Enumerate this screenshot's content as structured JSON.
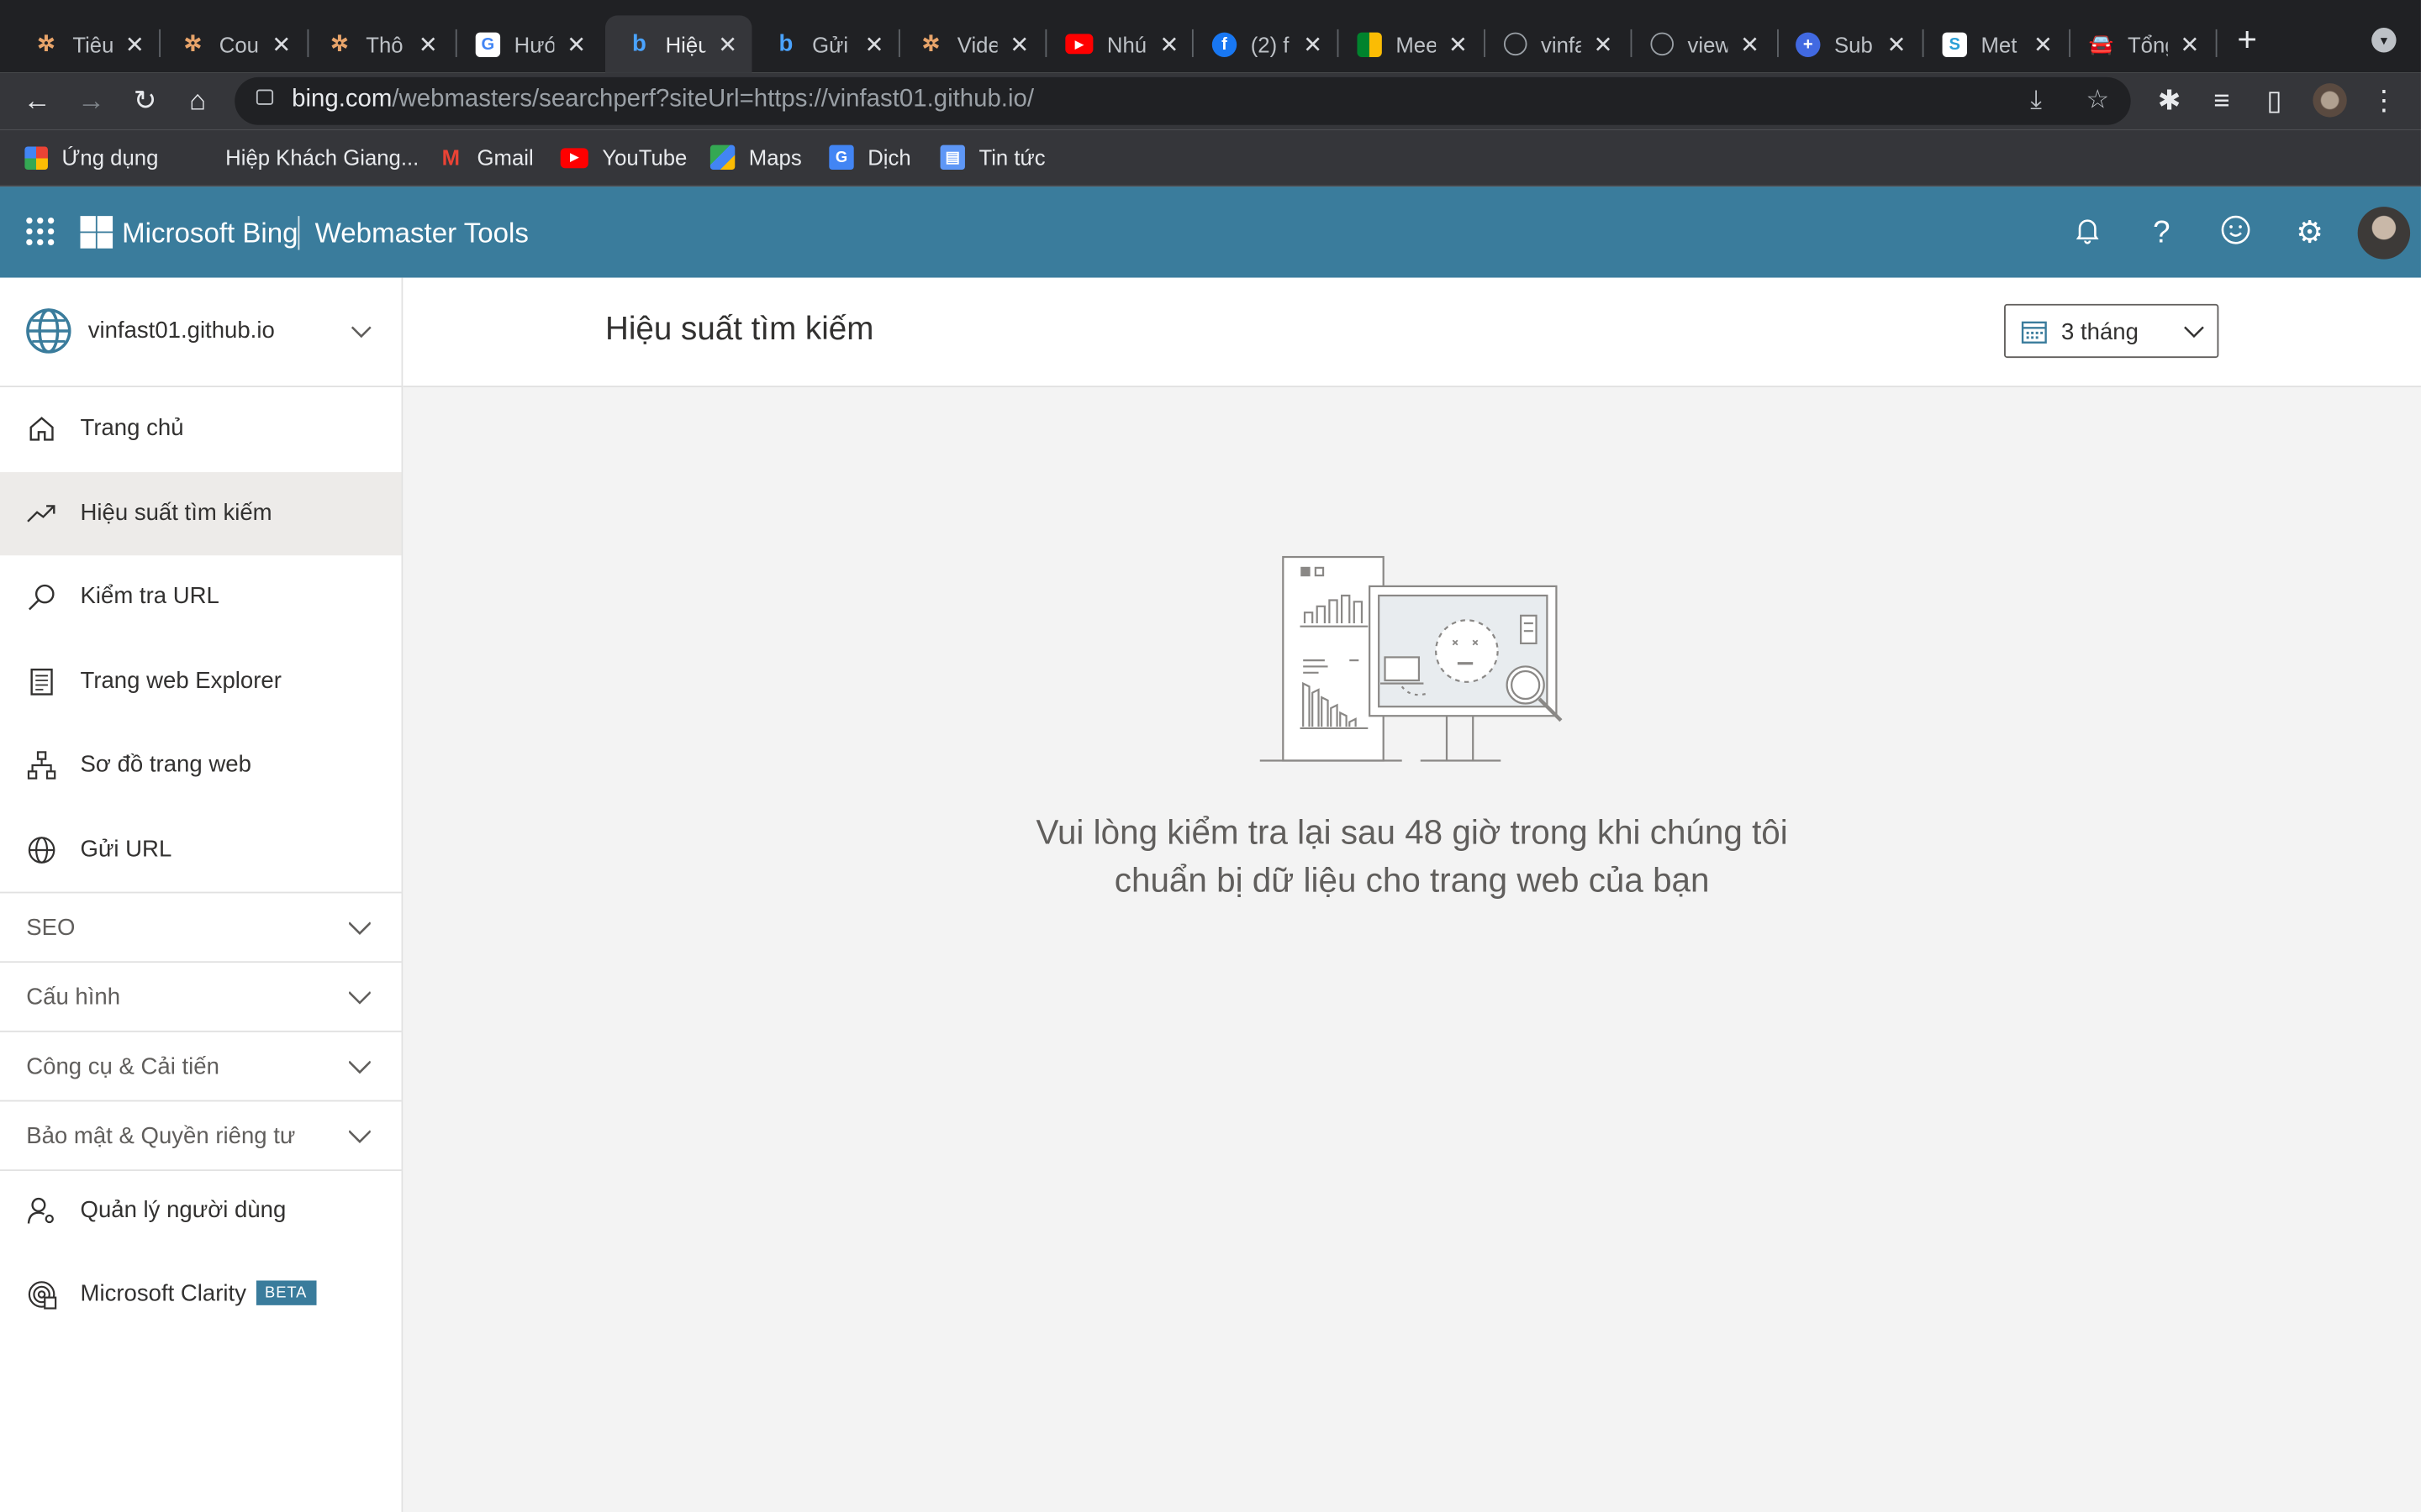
{
  "browser": {
    "tabs": [
      {
        "title": "Tiêu",
        "icon": "tiny-star-icon"
      },
      {
        "title": "Cou",
        "icon": "tiny-star-icon"
      },
      {
        "title": "Thô",
        "icon": "tiny-star-icon"
      },
      {
        "title": "Hướ",
        "icon": "google-icon"
      },
      {
        "title": "Hiệu",
        "icon": "bing-icon",
        "active": true
      },
      {
        "title": "Gửi",
        "icon": "bing-icon"
      },
      {
        "title": "Vide",
        "icon": "tiny-star-icon"
      },
      {
        "title": "Nhú",
        "icon": "youtube-icon"
      },
      {
        "title": "(2) f",
        "icon": "facebook-icon"
      },
      {
        "title": "Mee",
        "icon": "meet-icon"
      },
      {
        "title": "vinfa",
        "icon": "globe-icon"
      },
      {
        "title": "view",
        "icon": "globe-icon"
      },
      {
        "title": "Sub",
        "icon": "plus-circle-icon"
      },
      {
        "title": "Met",
        "icon": "seo-icon"
      },
      {
        "title": "Tổng",
        "icon": "car-icon"
      }
    ],
    "url_host": "bing.com",
    "url_path": "/webmasters/searchperf?siteUrl=https://vinfast01.github.io/",
    "bookmarks": [
      {
        "label": "Ứng dụng",
        "icon": "apps-grid-icon"
      },
      {
        "label": "Hiệp Khách Giang...",
        "icon": "none"
      },
      {
        "label": "Gmail",
        "icon": "gmail-icon"
      },
      {
        "label": "YouTube",
        "icon": "youtube-icon"
      },
      {
        "label": "Maps",
        "icon": "maps-icon"
      },
      {
        "label": "Dịch",
        "icon": "translate-icon"
      },
      {
        "label": "Tin tức",
        "icon": "news-icon"
      }
    ]
  },
  "header": {
    "brand": "Microsoft Bing",
    "product": "Webmaster Tools"
  },
  "sidebar": {
    "site": "vinfast01.github.io",
    "items": [
      {
        "label": "Trang chủ",
        "icon": "home-icon"
      },
      {
        "label": "Hiệu suất tìm kiếm",
        "icon": "trend-up-icon",
        "selected": true
      },
      {
        "label": "Kiểm tra URL",
        "icon": "search-icon"
      },
      {
        "label": "Trang web Explorer",
        "icon": "document-list-icon"
      },
      {
        "label": "Sơ đồ trang web",
        "icon": "sitemap-icon"
      },
      {
        "label": "Gửi URL",
        "icon": "globe-icon"
      }
    ],
    "groups": [
      {
        "label": "SEO"
      },
      {
        "label": "Cấu hình"
      },
      {
        "label": "Công cụ & Cải tiến"
      },
      {
        "label": "Bảo mật & Quyền riêng tư"
      }
    ],
    "bottom": [
      {
        "label": "Quản lý người dùng",
        "icon": "user-settings-icon"
      },
      {
        "label": "Microsoft Clarity",
        "icon": "clarity-icon",
        "badge": "BETA"
      }
    ]
  },
  "main": {
    "title": "Hiệu suất tìm kiếm",
    "range": "3 tháng",
    "message_line1": "Vui lòng kiểm tra lại sau 48 giờ trong khi chúng tôi",
    "message_line2": "chuẩn bị dữ liệu cho trang web của bạn"
  },
  "colors": {
    "header_bg": "#3a7c9c",
    "chrome_dark": "#202124",
    "chrome_toolbar": "#35363a",
    "selected_nav": "#edebe9",
    "content_bg": "#f3f3f3"
  }
}
